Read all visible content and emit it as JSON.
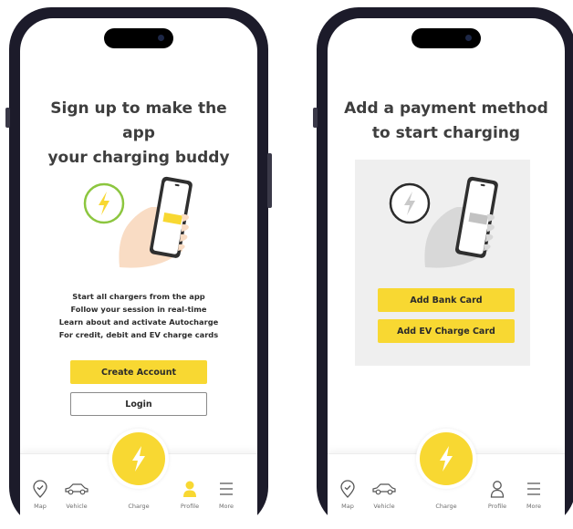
{
  "colors": {
    "accent": "#f8d832",
    "success": "#8cc63f",
    "text": "#3e3e3e",
    "panel": "#efefef"
  },
  "signup": {
    "title_line1": "Sign up to make the app",
    "title_line2": "your charging buddy",
    "bullets": [
      "Start all chargers from the app",
      "Follow your session in real-time",
      "Learn about and activate Autocharge",
      "For credit, debit and EV charge cards"
    ],
    "create_account_label": "Create Account",
    "login_label": "Login"
  },
  "payment": {
    "title_line1": "Add a payment method",
    "title_line2": "to start charging",
    "add_bank_card_label": "Add Bank Card",
    "add_ev_card_label": "Add EV Charge Card"
  },
  "nav": {
    "map_label": "Map",
    "vehicle_label": "Vehicle",
    "charge_label": "Charge",
    "profile_label": "Profile",
    "more_label": "More",
    "icons": [
      "map-pin-icon",
      "car-icon",
      "lightning-bolt-icon",
      "person-icon",
      "menu-icon"
    ]
  }
}
